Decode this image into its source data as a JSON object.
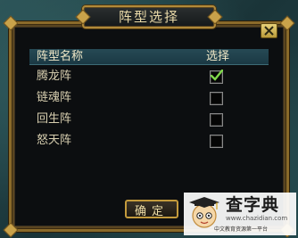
{
  "dialog": {
    "title": "阵型选择",
    "close_label": "✕",
    "header": {
      "name_col": "阵型名称",
      "select_col": "选择"
    },
    "rows": [
      {
        "label": "腾龙阵",
        "checked": true
      },
      {
        "label": "链魂阵",
        "checked": false
      },
      {
        "label": "回生阵",
        "checked": false
      },
      {
        "label": "怒天阵",
        "checked": false
      }
    ],
    "confirm_label": "确定"
  },
  "watermark": {
    "title": "查字典",
    "url": "www.chazidian.com",
    "subtitle": "中文教育资源第一平台"
  },
  "colors": {
    "frame_gold": "#b18a3a",
    "title_text": "#e9d9a8",
    "header_bg": "#264a55",
    "check_green": "#7fd84a"
  }
}
